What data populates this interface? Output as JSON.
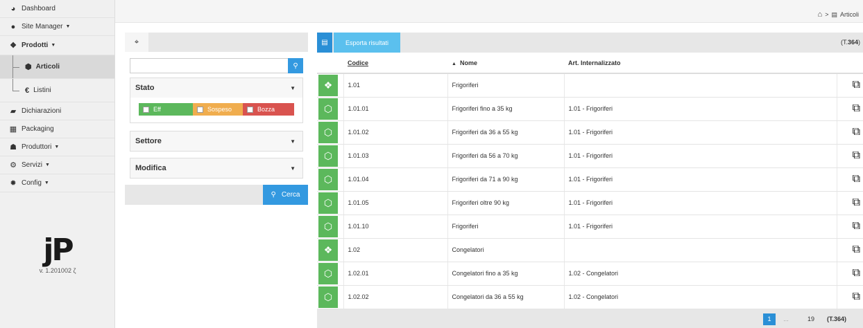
{
  "sidebar": {
    "items": [
      {
        "label": "Dashboard",
        "icon": "dashboard-icon"
      },
      {
        "label": "Site Manager",
        "icon": "globe-icon"
      },
      {
        "label": "Prodotti",
        "icon": "cubes-icon"
      },
      {
        "label": "Articoli",
        "icon": "cube-icon"
      },
      {
        "label": "Listini",
        "icon": "euro-icon"
      },
      {
        "label": "Dichiarazioni",
        "icon": "book-icon"
      },
      {
        "label": "Packaging",
        "icon": "grid-icon"
      },
      {
        "label": "Produttori",
        "icon": "users-icon"
      },
      {
        "label": "Servizi",
        "icon": "cogs-icon"
      },
      {
        "label": "Config",
        "icon": "gear-icon"
      }
    ],
    "logo": "jP",
    "version": "v. 1.201002 ζ"
  },
  "breadcrumb": {
    "current": "Articoli",
    "separator": ">"
  },
  "filter": {
    "search_placeholder": "",
    "stato": {
      "title": "Stato",
      "chips": [
        {
          "label": "Eff",
          "color": "#5cb85c"
        },
        {
          "label": "Sospeso",
          "color": "#f0ad4e"
        },
        {
          "label": "Bozza",
          "color": "#d9534f"
        }
      ]
    },
    "settore": {
      "title": "Settore"
    },
    "modifica": {
      "title": "Modifica"
    },
    "search_button": "Cerca"
  },
  "results": {
    "export_label": "Esporta risultati",
    "total_prefix": "(T.",
    "total": "364",
    "total_suffix": ")",
    "columns": {
      "codice": "Codice",
      "nome": "Nome",
      "art": "Art. Internalizzato"
    },
    "rows": [
      {
        "icon": "cubes-icon",
        "codice": "1.01",
        "nome": "Frigoriferi",
        "art": ""
      },
      {
        "icon": "cube-icon",
        "codice": "1.01.01",
        "nome": "Frigoriferi fino a 35 kg",
        "art": "1.01 - Frigoriferi"
      },
      {
        "icon": "cube-icon",
        "codice": "1.01.02",
        "nome": "Frigoriferi da 36 a 55 kg",
        "art": "1.01 - Frigoriferi"
      },
      {
        "icon": "cube-icon",
        "codice": "1.01.03",
        "nome": "Frigoriferi da 56 a 70 kg",
        "art": "1.01 - Frigoriferi"
      },
      {
        "icon": "cube-icon",
        "codice": "1.01.04",
        "nome": "Frigoriferi da 71 a 90 kg",
        "art": "1.01 - Frigoriferi"
      },
      {
        "icon": "cube-icon",
        "codice": "1.01.05",
        "nome": "Frigoriferi oltre 90 kg",
        "art": "1.01 - Frigoriferi"
      },
      {
        "icon": "cube-icon",
        "codice": "1.01.10",
        "nome": "Frigoriferi",
        "art": "1.01 - Frigoriferi"
      },
      {
        "icon": "cubes-icon",
        "codice": "1.02",
        "nome": "Congelatori",
        "art": ""
      },
      {
        "icon": "cube-icon",
        "codice": "1.02.01",
        "nome": "Congelatori fino a 35 kg",
        "art": "1.02 - Congelatori"
      },
      {
        "icon": "cube-icon",
        "codice": "1.02.02",
        "nome": "Congelatori da 36 a 55 kg",
        "art": "1.02 - Congelatori"
      }
    ],
    "pager": {
      "current": "1",
      "ellipsis": "...",
      "last": "19",
      "total": "(T.364)"
    }
  }
}
